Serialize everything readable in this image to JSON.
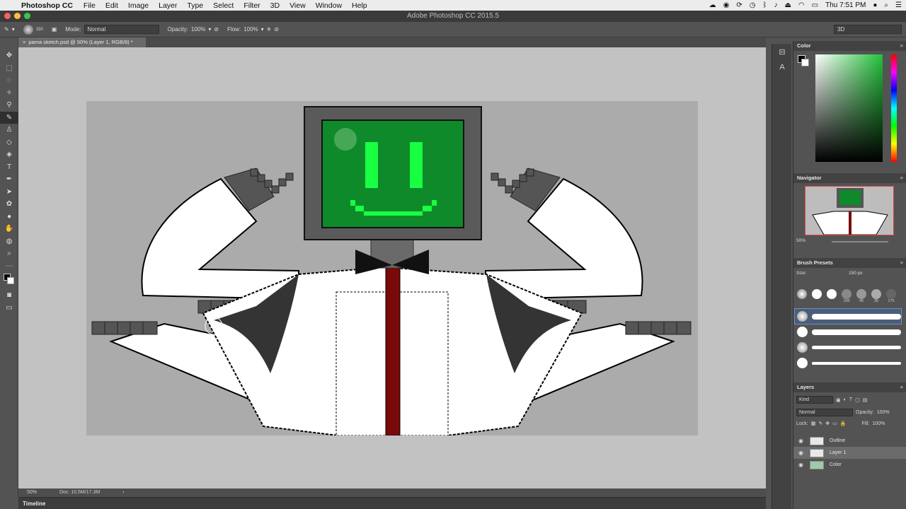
{
  "menubar": {
    "app_name": "Photoshop CC",
    "items": [
      "File",
      "Edit",
      "Image",
      "Layer",
      "Type",
      "Select",
      "Filter",
      "3D",
      "View",
      "Window",
      "Help"
    ],
    "clock": "Thu 7:51 PM"
  },
  "window": {
    "title": "Adobe Photoshop CC 2015.5"
  },
  "options": {
    "brush_size": "150",
    "mode_label": "Mode:",
    "mode_value": "Normal",
    "opacity_label": "Opacity:",
    "opacity_value": "100%",
    "flow_label": "Flow:",
    "flow_value": "100%",
    "workspace": "3D"
  },
  "document": {
    "tab_title": "pama sketch.psd @ 50% (Layer 1, RGB/8) *"
  },
  "status": {
    "zoom": "50%",
    "doc_size": "Doc: 10.5M/17.3M"
  },
  "timeline": {
    "label": "Timeline"
  },
  "panels": {
    "color": {
      "title": "Color"
    },
    "navigator": {
      "title": "Navigator",
      "zoom": "50%"
    },
    "brush_presets": {
      "title": "Brush Presets",
      "size_label": "Size:",
      "size_value": "150 px",
      "tips": [
        "",
        "",
        "",
        "100",
        "45",
        "36",
        "175"
      ]
    },
    "layers": {
      "title": "Layers",
      "filter": "Kind",
      "blend_mode": "Normal",
      "opacity_label": "Opacity:",
      "opacity_value": "100%",
      "lock_label": "Lock:",
      "fill_label": "Fill:",
      "fill_value": "100%",
      "items": [
        "Outline",
        "Layer 1",
        "Color"
      ]
    }
  },
  "colors": {
    "accent_green": "#19ff42",
    "screen_green": "#0e8a2a",
    "tie_red": "#7a0a0a",
    "selection_blue": "#4a5d7a"
  }
}
